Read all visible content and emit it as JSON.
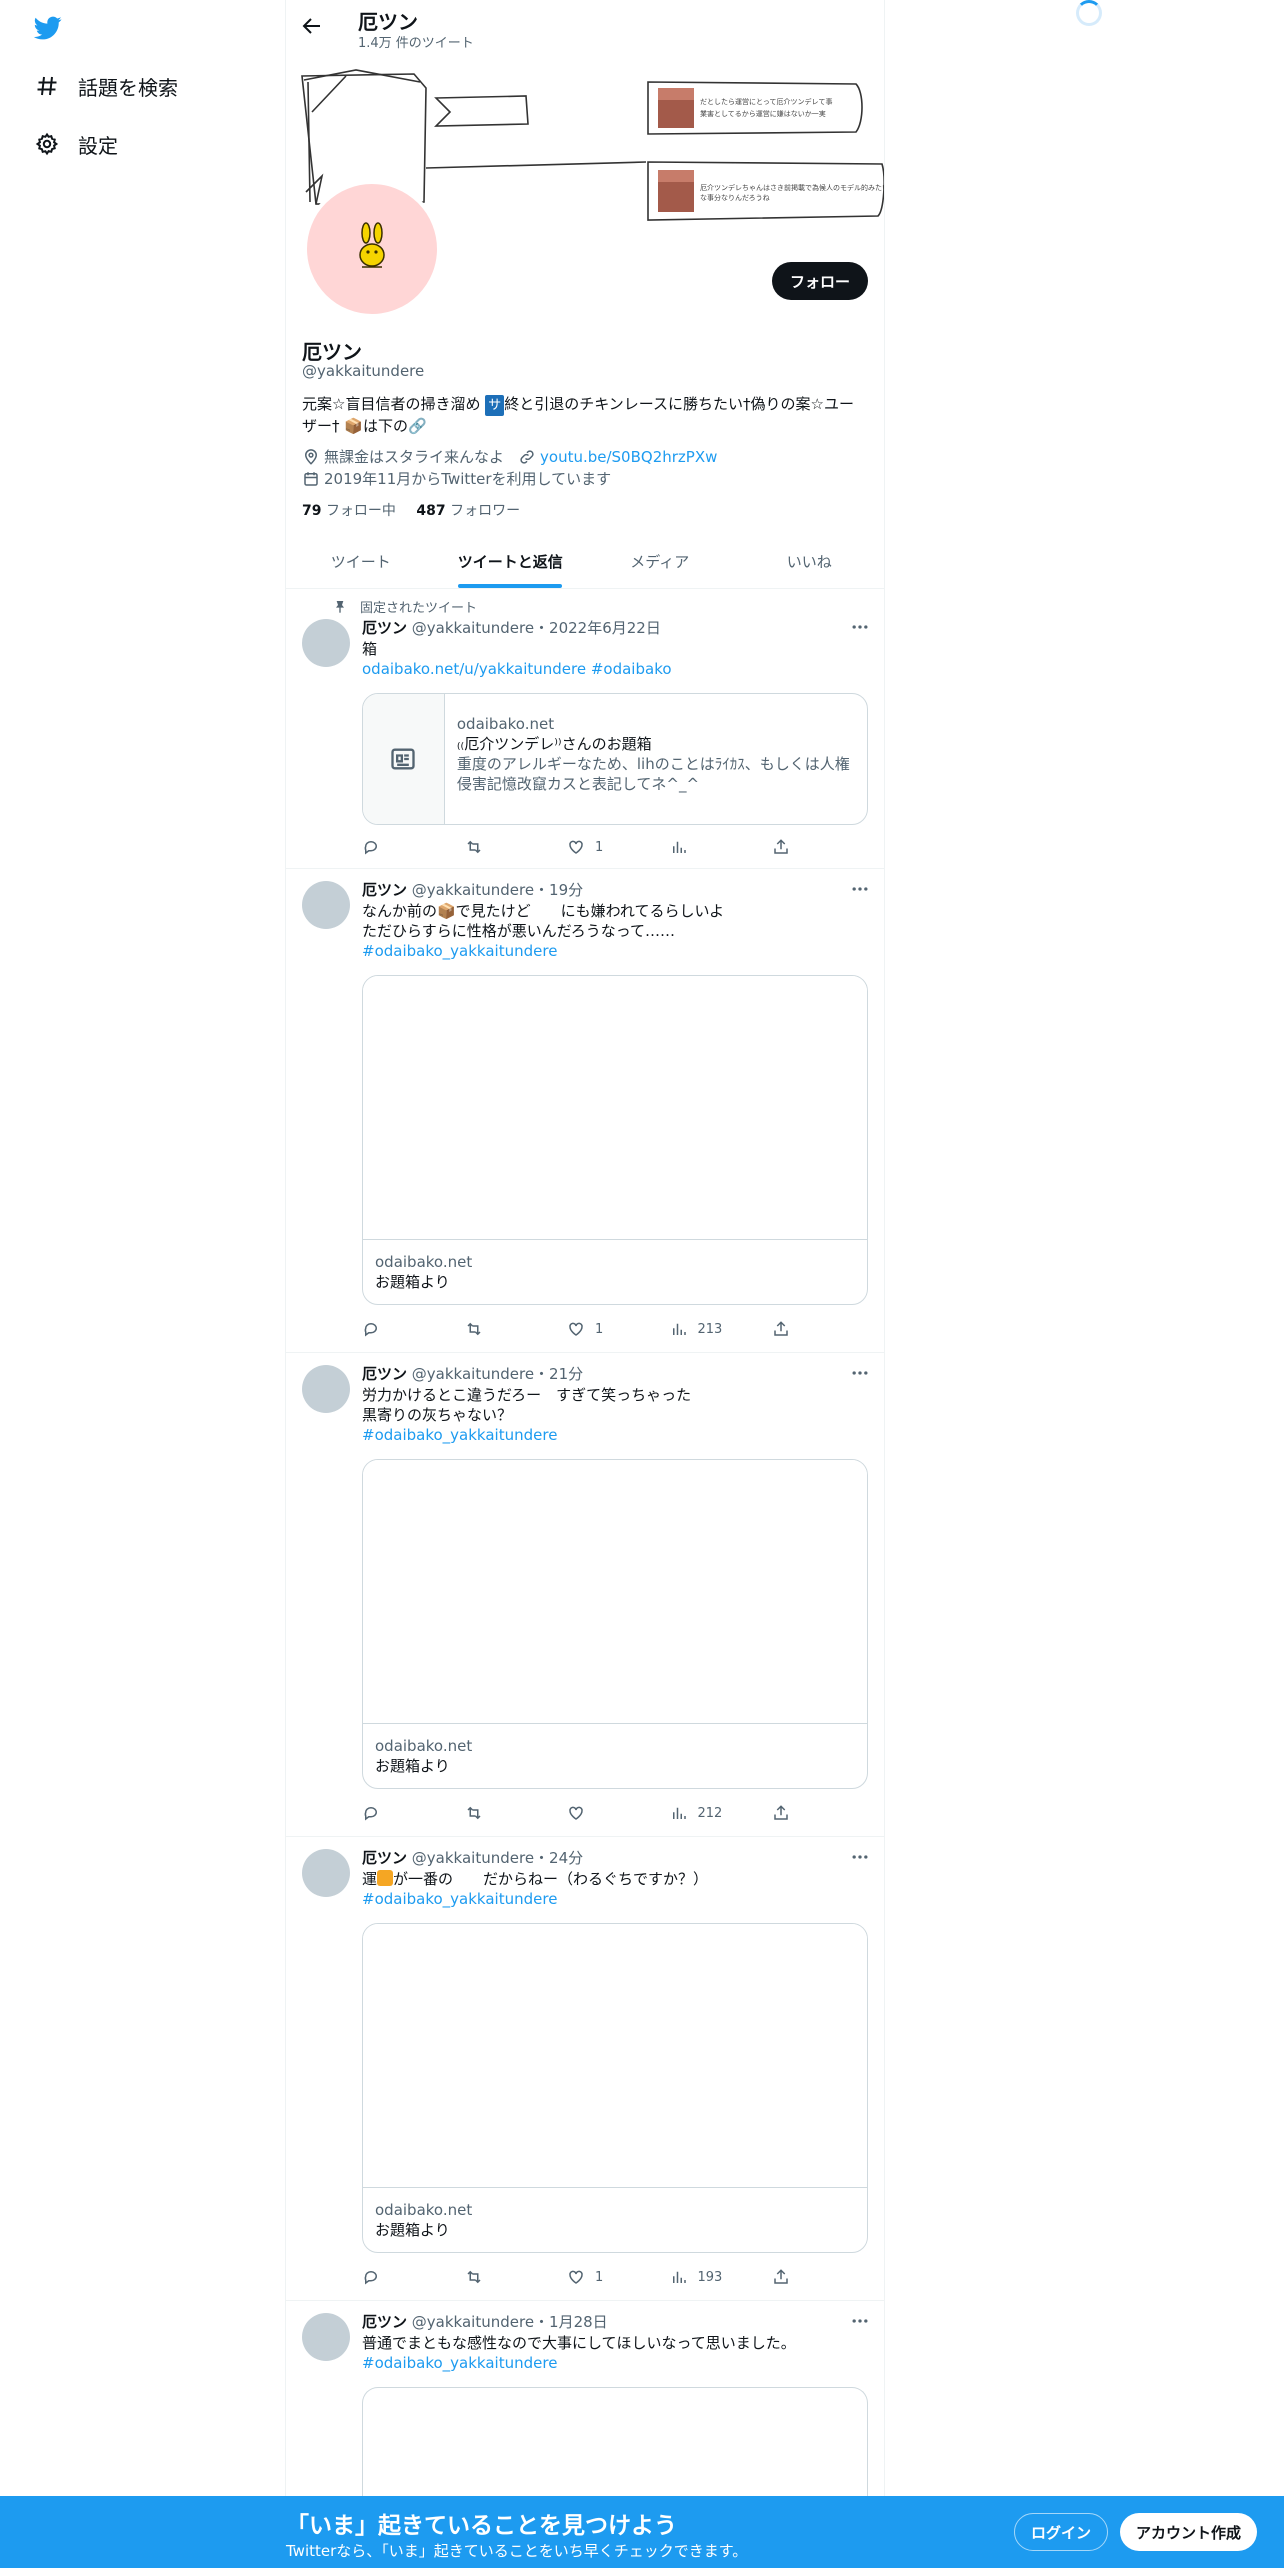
{
  "sidebar": {
    "items": [
      {
        "label": "話題を検索",
        "icon": "hashtag-icon"
      },
      {
        "label": "設定",
        "icon": "gear-icon"
      }
    ]
  },
  "header": {
    "title": "厄ツン",
    "subtitle": "1.4万 件のツイート"
  },
  "profile": {
    "name": "厄ツン",
    "handle": "@yakkaitundere",
    "follow_label": "フォロー",
    "bio_part1": "元案☆盲目信者の掃き溜め ",
    "bio_badge": "サ",
    "bio_part2": "終と引退のチキンレースに勝ちたい†偽りの案☆ユーザー† ",
    "bio_part3": "📦は下の🔗",
    "location": "無課金はスタライ来んなよ",
    "url": "youtu.be/S0BQ2hrzPXw",
    "joined": "2019年11月からTwitterを利用しています",
    "following_count": "79",
    "following_label": "フォロー中",
    "followers_count": "487",
    "followers_label": "フォロワー"
  },
  "tabs": [
    "ツイート",
    "ツイートと返信",
    "メディア",
    "いいね"
  ],
  "tweets": [
    {
      "pinned": "固定されたツイート",
      "name": "厄ツン",
      "meta": "@yakkaitundere・2022年6月22日",
      "lines": [
        "箱"
      ],
      "link_line": "odaibako.net/u/yakkaitundere #odaibako",
      "card_domain": "odaibako.net",
      "card_title": "₍₍厄介ツンデレ⁾⁾さんのお題箱",
      "card_desc": "重度のアレルギーなため、lihのことはﾗｲｶｽ、もしくは人権侵害記憶改竄カスと表記してネ^_^",
      "stats": {
        "reply": "",
        "retweet": "",
        "like": "1",
        "views": ""
      }
    },
    {
      "name": "厄ツン",
      "meta": "@yakkaitundere・19分",
      "lines": [
        "なんか前の📦で見たけど　　にも嫌われてるらしいよ",
        "ただひらすらに性格が悪いんだろうなって……"
      ],
      "hashtag": "#odaibako_yakkaitundere",
      "card_domain": "odaibako.net",
      "card_title": "お題箱より",
      "stats": {
        "reply": "",
        "retweet": "",
        "like": "1",
        "views": "213"
      }
    },
    {
      "name": "厄ツン",
      "meta": "@yakkaitundere・21分",
      "lines": [
        "労力かけるとこ違うだろー　すぎて笑っちゃった",
        "黒寄りの灰ちゃない？"
      ],
      "hashtag": "#odaibako_yakkaitundere",
      "card_domain": "odaibako.net",
      "card_title": "お題箱より",
      "stats": {
        "reply": "",
        "retweet": "",
        "like": "",
        "views": "212"
      }
    },
    {
      "name": "厄ツン",
      "meta": "@yakkaitundere・24分",
      "lines_pre": "運",
      "lines_post": "が一番の　　だからねー（わるぐちですか？）",
      "hashtag": "#odaibako_yakkaitundere",
      "card_domain": "odaibako.net",
      "card_title": "お題箱より",
      "stats": {
        "reply": "",
        "retweet": "",
        "like": "1",
        "views": "193"
      }
    },
    {
      "name": "厄ツン",
      "meta": "@yakkaitundere・1月28日",
      "lines": [
        "普通でまともな感性なので大事にしてほしいなって思いました。"
      ],
      "hashtag": "#odaibako_yakkaitundere"
    }
  ],
  "banner_notes": [
    "だとしたら運営にとって厄介ツンデレて事",
    "業害としてるから運営に嫌はないか一実",
    "厄介ツンデレちゃんはさき前掲載で為候人のモデル的みたい",
    "な事分なりんだろうね"
  ],
  "bottom_bar": {
    "title": "「いま」起きていることを見つけよう",
    "subtitle": "Twitterなら、「いま」起きていることをいち早くチェックできます。",
    "login_label": "ログイン",
    "signup_label": "アカウント作成"
  },
  "colors": {
    "accent": "#1d9bf0",
    "text": "#0f1419",
    "muted": "#536471",
    "avatar_bg": "#ffd6d6"
  }
}
